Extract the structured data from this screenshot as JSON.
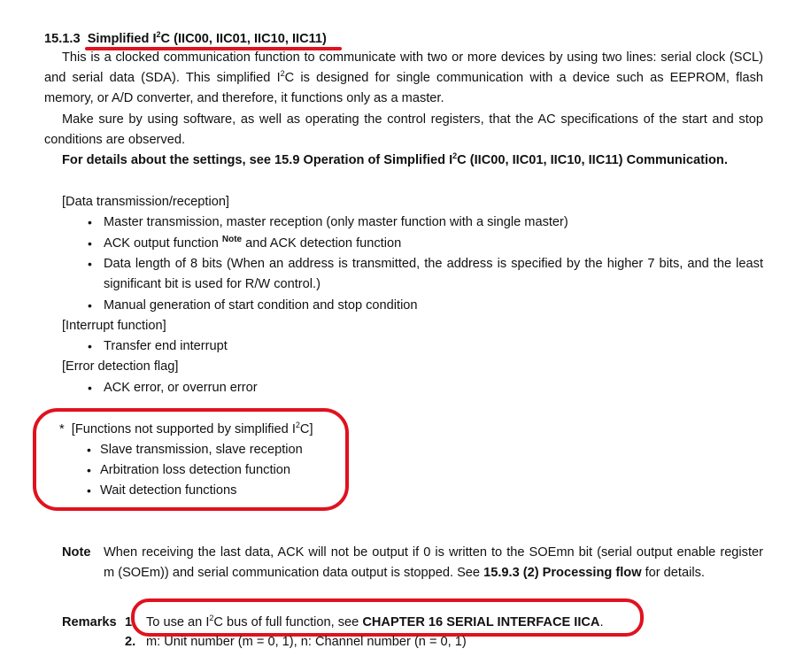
{
  "heading": {
    "number": "15.1.3",
    "title_a": "Simplified I",
    "title_sup": "2",
    "title_b": "C (IIC00, IIC01, IIC10, IIC11)"
  },
  "intro": {
    "line1": "This is a clocked communication function to communicate with two or more devices by using two lines: serial clock (SCL)",
    "line2_a": "and serial data (SDA).  This simplified I",
    "line2_sup": "2",
    "line2_b": "C is designed for single communication with a device such as EEPROM, flash",
    "line3": "memory, or A/D converter, and therefore, it functions only as a master.",
    "line4": "Make sure by using software, as well as operating the control registers, that the AC specifications of the start and stop",
    "line5": "conditions are observed.",
    "details_a": "For details about the settings, see 15.9 Operation of Simplified I",
    "details_sup": "2",
    "details_b": "C (IIC00, IIC01, IIC10, IIC11) Communication."
  },
  "data_tx": {
    "label": "[Data transmission/reception]",
    "item1": "Master transmission, master reception (only master function with a single master)",
    "item2_a": "ACK output function ",
    "item2_note": "Note",
    "item2_b": " and ACK detection function",
    "item3_line1": "Data length of 8 bits (When an address is transmitted, the address is specified by the higher 7 bits, and the least",
    "item3_line2": "significant bit is used for R/W control.)",
    "item4": "Manual generation of start condition and stop condition"
  },
  "interrupt": {
    "label": "[Interrupt function]",
    "item1": "Transfer end interrupt"
  },
  "error": {
    "label": "[Error detection flag]",
    "item1": "ACK error, or overrun error"
  },
  "unsupported": {
    "star": "*",
    "label_a": "[Functions not supported by simplified I",
    "label_sup": "2",
    "label_b": "C]",
    "item1": "Slave transmission, slave reception",
    "item2": "Arbitration loss detection function",
    "item3": "Wait detection functions"
  },
  "note": {
    "label": "Note",
    "line1": "When receiving the last data, ACK will not be output if 0 is written to the SOEmn bit (serial output enable register",
    "line2_a": "m (SOEm)) and serial communication data output is stopped.  See ",
    "line2_bold": "15.9.3 (2) Processing flow",
    "line2_b": " for details."
  },
  "remarks": {
    "label": "Remarks",
    "num1": "1.",
    "r1_a": "To use an I",
    "r1_sup": "2",
    "r1_b": "C bus of full function, see ",
    "r1_bold": "CHAPTER 16  SERIAL INTERFACE IICA",
    "r1_c": ".",
    "num2": "2.",
    "r2": "m: Unit number (m = 0, 1), n: Channel number (n = 0, 1)"
  },
  "annotation_color": "#e0121e"
}
